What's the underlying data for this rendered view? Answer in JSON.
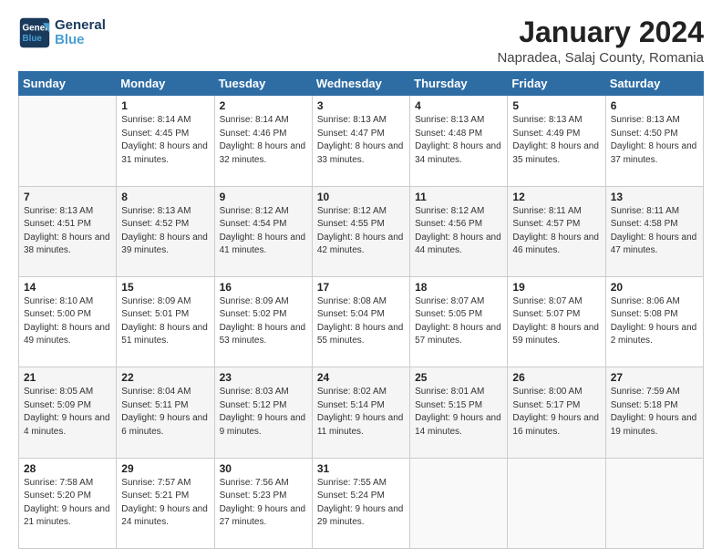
{
  "header": {
    "logo_line1": "General",
    "logo_line2": "Blue",
    "title": "January 2024",
    "subtitle": "Napradea, Salaj County, Romania"
  },
  "weekdays": [
    "Sunday",
    "Monday",
    "Tuesday",
    "Wednesday",
    "Thursday",
    "Friday",
    "Saturday"
  ],
  "weeks": [
    [
      {
        "day": "",
        "sunrise": "",
        "sunset": "",
        "daylight": ""
      },
      {
        "day": "1",
        "sunrise": "Sunrise: 8:14 AM",
        "sunset": "Sunset: 4:45 PM",
        "daylight": "Daylight: 8 hours and 31 minutes."
      },
      {
        "day": "2",
        "sunrise": "Sunrise: 8:14 AM",
        "sunset": "Sunset: 4:46 PM",
        "daylight": "Daylight: 8 hours and 32 minutes."
      },
      {
        "day": "3",
        "sunrise": "Sunrise: 8:13 AM",
        "sunset": "Sunset: 4:47 PM",
        "daylight": "Daylight: 8 hours and 33 minutes."
      },
      {
        "day": "4",
        "sunrise": "Sunrise: 8:13 AM",
        "sunset": "Sunset: 4:48 PM",
        "daylight": "Daylight: 8 hours and 34 minutes."
      },
      {
        "day": "5",
        "sunrise": "Sunrise: 8:13 AM",
        "sunset": "Sunset: 4:49 PM",
        "daylight": "Daylight: 8 hours and 35 minutes."
      },
      {
        "day": "6",
        "sunrise": "Sunrise: 8:13 AM",
        "sunset": "Sunset: 4:50 PM",
        "daylight": "Daylight: 8 hours and 37 minutes."
      }
    ],
    [
      {
        "day": "7",
        "sunrise": "Sunrise: 8:13 AM",
        "sunset": "Sunset: 4:51 PM",
        "daylight": "Daylight: 8 hours and 38 minutes."
      },
      {
        "day": "8",
        "sunrise": "Sunrise: 8:13 AM",
        "sunset": "Sunset: 4:52 PM",
        "daylight": "Daylight: 8 hours and 39 minutes."
      },
      {
        "day": "9",
        "sunrise": "Sunrise: 8:12 AM",
        "sunset": "Sunset: 4:54 PM",
        "daylight": "Daylight: 8 hours and 41 minutes."
      },
      {
        "day": "10",
        "sunrise": "Sunrise: 8:12 AM",
        "sunset": "Sunset: 4:55 PM",
        "daylight": "Daylight: 8 hours and 42 minutes."
      },
      {
        "day": "11",
        "sunrise": "Sunrise: 8:12 AM",
        "sunset": "Sunset: 4:56 PM",
        "daylight": "Daylight: 8 hours and 44 minutes."
      },
      {
        "day": "12",
        "sunrise": "Sunrise: 8:11 AM",
        "sunset": "Sunset: 4:57 PM",
        "daylight": "Daylight: 8 hours and 46 minutes."
      },
      {
        "day": "13",
        "sunrise": "Sunrise: 8:11 AM",
        "sunset": "Sunset: 4:58 PM",
        "daylight": "Daylight: 8 hours and 47 minutes."
      }
    ],
    [
      {
        "day": "14",
        "sunrise": "Sunrise: 8:10 AM",
        "sunset": "Sunset: 5:00 PM",
        "daylight": "Daylight: 8 hours and 49 minutes."
      },
      {
        "day": "15",
        "sunrise": "Sunrise: 8:09 AM",
        "sunset": "Sunset: 5:01 PM",
        "daylight": "Daylight: 8 hours and 51 minutes."
      },
      {
        "day": "16",
        "sunrise": "Sunrise: 8:09 AM",
        "sunset": "Sunset: 5:02 PM",
        "daylight": "Daylight: 8 hours and 53 minutes."
      },
      {
        "day": "17",
        "sunrise": "Sunrise: 8:08 AM",
        "sunset": "Sunset: 5:04 PM",
        "daylight": "Daylight: 8 hours and 55 minutes."
      },
      {
        "day": "18",
        "sunrise": "Sunrise: 8:07 AM",
        "sunset": "Sunset: 5:05 PM",
        "daylight": "Daylight: 8 hours and 57 minutes."
      },
      {
        "day": "19",
        "sunrise": "Sunrise: 8:07 AM",
        "sunset": "Sunset: 5:07 PM",
        "daylight": "Daylight: 8 hours and 59 minutes."
      },
      {
        "day": "20",
        "sunrise": "Sunrise: 8:06 AM",
        "sunset": "Sunset: 5:08 PM",
        "daylight": "Daylight: 9 hours and 2 minutes."
      }
    ],
    [
      {
        "day": "21",
        "sunrise": "Sunrise: 8:05 AM",
        "sunset": "Sunset: 5:09 PM",
        "daylight": "Daylight: 9 hours and 4 minutes."
      },
      {
        "day": "22",
        "sunrise": "Sunrise: 8:04 AM",
        "sunset": "Sunset: 5:11 PM",
        "daylight": "Daylight: 9 hours and 6 minutes."
      },
      {
        "day": "23",
        "sunrise": "Sunrise: 8:03 AM",
        "sunset": "Sunset: 5:12 PM",
        "daylight": "Daylight: 9 hours and 9 minutes."
      },
      {
        "day": "24",
        "sunrise": "Sunrise: 8:02 AM",
        "sunset": "Sunset: 5:14 PM",
        "daylight": "Daylight: 9 hours and 11 minutes."
      },
      {
        "day": "25",
        "sunrise": "Sunrise: 8:01 AM",
        "sunset": "Sunset: 5:15 PM",
        "daylight": "Daylight: 9 hours and 14 minutes."
      },
      {
        "day": "26",
        "sunrise": "Sunrise: 8:00 AM",
        "sunset": "Sunset: 5:17 PM",
        "daylight": "Daylight: 9 hours and 16 minutes."
      },
      {
        "day": "27",
        "sunrise": "Sunrise: 7:59 AM",
        "sunset": "Sunset: 5:18 PM",
        "daylight": "Daylight: 9 hours and 19 minutes."
      }
    ],
    [
      {
        "day": "28",
        "sunrise": "Sunrise: 7:58 AM",
        "sunset": "Sunset: 5:20 PM",
        "daylight": "Daylight: 9 hours and 21 minutes."
      },
      {
        "day": "29",
        "sunrise": "Sunrise: 7:57 AM",
        "sunset": "Sunset: 5:21 PM",
        "daylight": "Daylight: 9 hours and 24 minutes."
      },
      {
        "day": "30",
        "sunrise": "Sunrise: 7:56 AM",
        "sunset": "Sunset: 5:23 PM",
        "daylight": "Daylight: 9 hours and 27 minutes."
      },
      {
        "day": "31",
        "sunrise": "Sunrise: 7:55 AM",
        "sunset": "Sunset: 5:24 PM",
        "daylight": "Daylight: 9 hours and 29 minutes."
      },
      {
        "day": "",
        "sunrise": "",
        "sunset": "",
        "daylight": ""
      },
      {
        "day": "",
        "sunrise": "",
        "sunset": "",
        "daylight": ""
      },
      {
        "day": "",
        "sunrise": "",
        "sunset": "",
        "daylight": ""
      }
    ]
  ]
}
